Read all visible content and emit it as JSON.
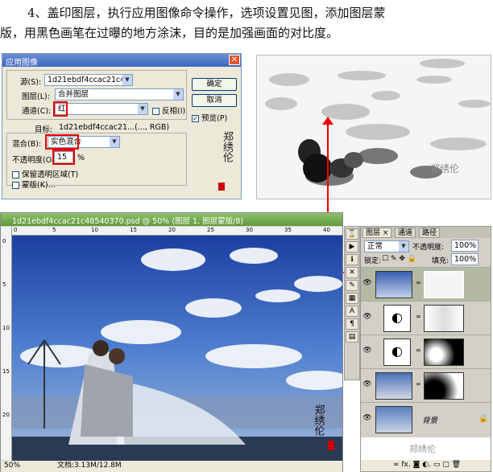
{
  "instruction": {
    "line1": "4、盖印图层，执行应用图像命令操作，选项设置见图，添加图层蒙",
    "line2": "版，用黑色画笔在过曝的地方涂沫，目的是加强画面的对比度。"
  },
  "dialog": {
    "title": "应用图像",
    "source_label": "源(S):",
    "source_value": "1d21ebdf4ccac21c4854...",
    "layer_label": "图层(L):",
    "layer_value": "合并图层",
    "channel_label": "通道(C):",
    "channel_value": "红",
    "invert_label": "反相(I)",
    "target_label": "目标:",
    "target_value": "1d21ebdf4ccac21...(..., RGB)",
    "blend_label": "混合(B):",
    "blend_value": "实色混合",
    "opacity_label": "不透明度(O):",
    "opacity_value": "15",
    "opacity_unit": "%",
    "preserve_label": "保留透明区域(T)",
    "mask_label": "蒙版(K)...",
    "ok_label": "确定",
    "cancel_label": "取消",
    "preview_label": "预览(P)",
    "signature": "郑绣伦"
  },
  "document": {
    "title": "1d21ebdf4ccac21c48540370.psd @ 50% (图层 1, 图层蒙版/8)",
    "zoom": "50%",
    "doc_size": "文档:3.13M/12.8M",
    "ruler_marks": [
      "0",
      "5",
      "10",
      "15",
      "20",
      "25",
      "30",
      "35",
      "40"
    ],
    "ruler_v_marks": [
      "0",
      "5",
      "10",
      "15",
      "20"
    ],
    "signature": "郑绣伦"
  },
  "layers_panel": {
    "tabs": [
      "图层 ×",
      "通道",
      "路径"
    ],
    "blend_mode": "正常",
    "opacity_label": "不透明度:",
    "opacity_value": "100%",
    "lock_label": "锁定:",
    "fill_label": "填充:",
    "fill_value": "100%",
    "background_layer_name": "背景"
  },
  "colors": {
    "annotation_red": "#e00000",
    "dialog_bg": "#ece9d8",
    "selected_layer": "#b4b9a4"
  }
}
